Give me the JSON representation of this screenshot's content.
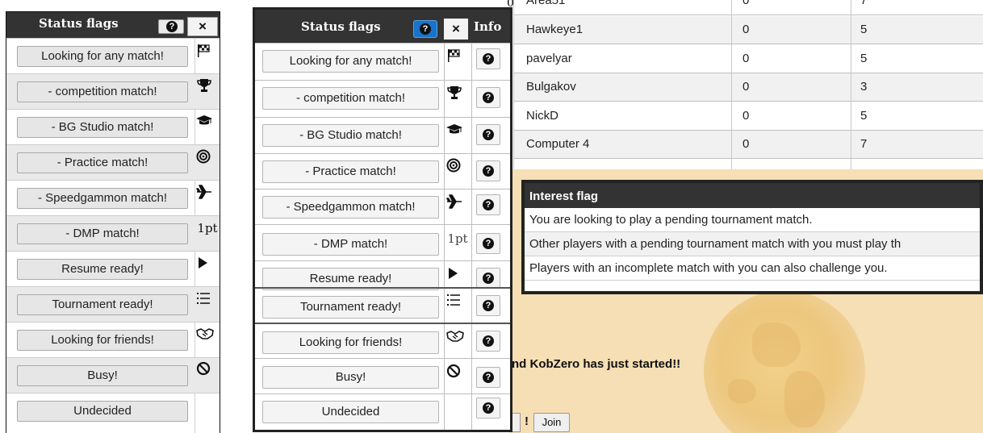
{
  "left_panel": {
    "title": "Status flags",
    "help_icon": "question-circle-icon",
    "close_label": "×",
    "rows": [
      {
        "label": "Looking for any match!",
        "icon": "checkered-flag-icon"
      },
      {
        "label": "- competition match!",
        "icon": "trophy-icon"
      },
      {
        "label": "- BG Studio match!",
        "icon": "graduation-cap-icon"
      },
      {
        "label": "- Practice match!",
        "icon": "target-icon"
      },
      {
        "label": "- Speedgammon match!",
        "icon": "plane-icon"
      },
      {
        "label": "- DMP match!",
        "icon": "1pt-text-icon",
        "icon_text": "1pt"
      },
      {
        "label": "Resume ready!",
        "icon": "play-icon"
      },
      {
        "label": "Tournament ready!",
        "icon": "list-icon"
      },
      {
        "label": "Looking for friends!",
        "icon": "handshake-icon"
      },
      {
        "label": "Busy!",
        "icon": "ban-icon"
      },
      {
        "label": "Undecided",
        "icon": ""
      }
    ]
  },
  "middle_panel": {
    "title": "Status flags",
    "help_icon": "question-circle-icon",
    "close_label": "×",
    "info_header": "Info",
    "rows": [
      {
        "label": "Looking for any match!",
        "icon": "checkered-flag-icon"
      },
      {
        "label": "- competition match!",
        "icon": "trophy-icon"
      },
      {
        "label": "- BG Studio match!",
        "icon": "graduation-cap-icon"
      },
      {
        "label": "- Practice match!",
        "icon": "target-icon"
      },
      {
        "label": "- Speedgammon match!",
        "icon": "plane-icon"
      },
      {
        "label": "- DMP match!",
        "icon": "1pt-text-icon",
        "icon_text": "1pt"
      },
      {
        "label": "Resume ready!",
        "icon": "play-icon"
      },
      {
        "label": "Tournament ready!",
        "icon": "list-icon"
      },
      {
        "label": "Looking for friends!",
        "icon": "handshake-icon"
      },
      {
        "label": "Busy!",
        "icon": "ban-icon"
      },
      {
        "label": "Undecided",
        "icon": ""
      }
    ]
  },
  "players_table": {
    "rows": [
      {
        "name": "Area51",
        "col2": "0",
        "col3": "7"
      },
      {
        "name": "Hawkeye1",
        "col2": "0",
        "col3": "5"
      },
      {
        "name": "pavelyar",
        "col2": "0",
        "col3": "5"
      },
      {
        "name": "Bulgakov",
        "col2": "0",
        "col3": "3"
      },
      {
        "name": "NickD",
        "col2": "0",
        "col3": "5"
      },
      {
        "name": "Computer 4",
        "col2": "0",
        "col3": "7"
      }
    ],
    "first_col_fragment": "0"
  },
  "interest_flag": {
    "title": "Interest flag",
    "lines": [
      "You are looking to play a pending tournament match.",
      "Other players with a pending tournament match with you must play th",
      "Players with an incomplete match with you can also challenge you."
    ]
  },
  "announcement": "nd KobZero has just started!!",
  "exclamation": "!",
  "join_label": "Join"
}
